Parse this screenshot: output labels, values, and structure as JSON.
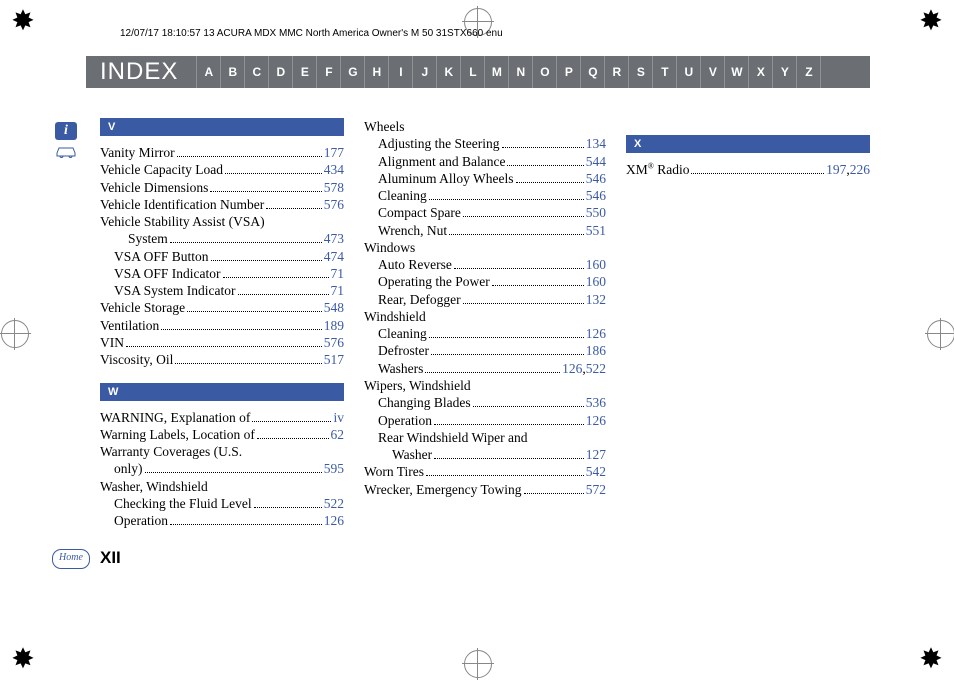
{
  "header_meta": "12/07/17 18:10:57   13 ACURA MDX MMC North America Owner's M 50 31STX660 enu",
  "index_title": "INDEX",
  "alphabet": [
    "A",
    "B",
    "C",
    "D",
    "E",
    "F",
    "G",
    "H",
    "I",
    "J",
    "K",
    "L",
    "M",
    "N",
    "O",
    "P",
    "Q",
    "R",
    "S",
    "T",
    "U",
    "V",
    "W",
    "X",
    "Y",
    "Z"
  ],
  "info_icon": "i",
  "home_label": "Home",
  "page_number": "XII",
  "sections": {
    "V": {
      "header": "V",
      "entries": [
        {
          "label": "Vanity Mirror",
          "page": "177"
        },
        {
          "label": "Vehicle Capacity Load",
          "page": "434"
        },
        {
          "label": "Vehicle Dimensions",
          "page": "578"
        },
        {
          "label": "Vehicle Identification Number",
          "page": "576"
        },
        {
          "label": "Vehicle Stability Assist (VSA)",
          "group": true
        },
        {
          "label": "System",
          "page": "473",
          "level": "subsub-wrap"
        },
        {
          "label": "VSA OFF Button",
          "page": "474",
          "level": "sub"
        },
        {
          "label": "VSA OFF Indicator",
          "page": "71",
          "level": "sub"
        },
        {
          "label": "VSA System Indicator",
          "page": "71",
          "level": "sub"
        },
        {
          "label": "Vehicle Storage",
          "page": "548"
        },
        {
          "label": "Ventilation",
          "page": "189"
        },
        {
          "label": "VIN",
          "page": "576"
        },
        {
          "label": "Viscosity, Oil",
          "page": "517"
        }
      ]
    },
    "W": {
      "header": "W",
      "entries_col1": [
        {
          "label": "WARNING, Explanation of",
          "page": "iv"
        },
        {
          "label": "Warning Labels, Location of",
          "page": "62"
        },
        {
          "label": "Warranty Coverages (U.S.",
          "group": true
        },
        {
          "label": "only)",
          "page": "595",
          "level": "sub"
        },
        {
          "label": "Washer, Windshield",
          "group": true
        },
        {
          "label": "Checking the Fluid Level",
          "page": "522",
          "level": "sub"
        },
        {
          "label": "Operation",
          "page": "126",
          "level": "sub"
        }
      ],
      "entries_col2": [
        {
          "label": "Wheels",
          "group": true
        },
        {
          "label": "Adjusting the Steering",
          "page": "134",
          "level": "sub"
        },
        {
          "label": "Alignment and Balance",
          "page": "544",
          "level": "sub"
        },
        {
          "label": "Aluminum Alloy Wheels",
          "page": "546",
          "level": "sub"
        },
        {
          "label": "Cleaning",
          "page": "546",
          "level": "sub"
        },
        {
          "label": "Compact Spare",
          "page": "550",
          "level": "sub"
        },
        {
          "label": "Wrench, Nut",
          "page": "551",
          "level": "sub"
        },
        {
          "label": "Windows",
          "group": true
        },
        {
          "label": "Auto Reverse",
          "page": "160",
          "level": "sub"
        },
        {
          "label": "Operating the Power",
          "page": "160",
          "level": "sub"
        },
        {
          "label": "Rear, Defogger",
          "page": "132",
          "level": "sub"
        },
        {
          "label": "Windshield",
          "group": true
        },
        {
          "label": "Cleaning",
          "page": "126",
          "level": "sub"
        },
        {
          "label": "Defroster",
          "page": "186",
          "level": "sub"
        },
        {
          "label": "Washers",
          "pages": [
            "126",
            "522"
          ],
          "level": "sub"
        },
        {
          "label": "Wipers, Windshield",
          "group": true
        },
        {
          "label": "Changing Blades",
          "page": "536",
          "level": "sub"
        },
        {
          "label": "Operation",
          "page": "126",
          "level": "sub"
        },
        {
          "label": "Rear Windshield Wiper and",
          "group": true,
          "level": "sub"
        },
        {
          "label": "Washer",
          "page": "127",
          "level": "subsub"
        },
        {
          "label": "Worn Tires",
          "page": "542"
        },
        {
          "label": "Wrecker, Emergency Towing",
          "page": "572"
        }
      ]
    },
    "X": {
      "header": "X",
      "entries": [
        {
          "label": "XM® Radio",
          "pages": [
            "197",
            "226"
          ]
        }
      ]
    }
  }
}
